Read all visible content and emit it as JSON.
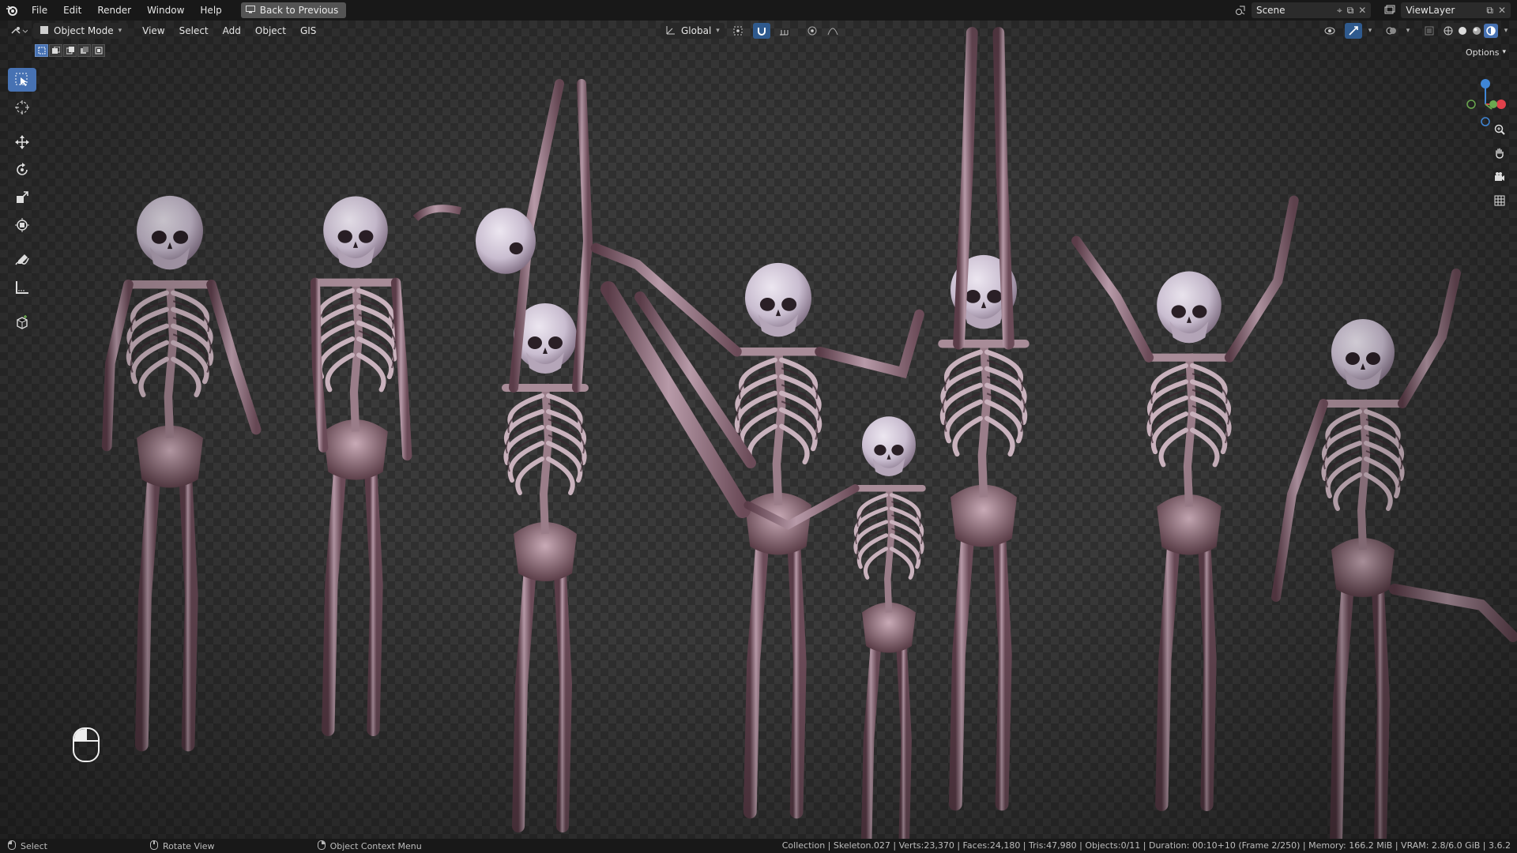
{
  "topbar": {
    "menu": [
      "File",
      "Edit",
      "Render",
      "Window",
      "Help"
    ],
    "back_button": "Back to Previous",
    "scene": "Scene",
    "view_layer": "ViewLayer"
  },
  "viewport_header": {
    "mode": "Object Mode",
    "menus": [
      "View",
      "Select",
      "Add",
      "Object",
      "GIS"
    ],
    "transform_orientation": "Global",
    "options": "Options"
  },
  "toolbar": {
    "tools": [
      "select-box",
      "cursor",
      "move",
      "rotate",
      "scale",
      "transform",
      "annotate",
      "measure",
      "add-cube"
    ],
    "active_tool": "select-box"
  },
  "statusbar": {
    "left": [
      "Select",
      "Rotate View",
      "Object Context Menu"
    ],
    "stats": "Collection | Skeleton.027 | Verts:23,370 | Faces:24,180 | Tris:47,980 | Objects:0/11 | Duration: 00:10+10 (Frame 2/250) | Memory: 166.2 MiB | VRAM: 2.8/6.0 GiB | 3.6.2"
  },
  "colors": {
    "accent": "#4772b3",
    "bone": "#b79aa8",
    "bone_dark": "#5a3c48",
    "skull": "#d8cfdc",
    "axis_x": "#e0414b",
    "axis_y": "#6aa84f",
    "axis_z": "#3f86d6"
  }
}
